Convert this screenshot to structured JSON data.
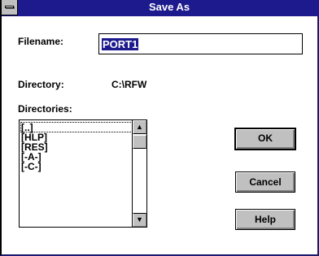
{
  "window": {
    "title": "Save As"
  },
  "filename": {
    "label": "Filename:",
    "value": "PORT1"
  },
  "directory": {
    "label": "Directory:",
    "value": "C:\\RFW"
  },
  "directories": {
    "label": "Directories:",
    "items": [
      "[..]",
      "[HLP]",
      "[RES]",
      "[-A-]",
      "[-C-]"
    ]
  },
  "scrollbar": {
    "up_glyph": "▲",
    "down_glyph": "▼"
  },
  "buttons": {
    "ok": "OK",
    "cancel": "Cancel",
    "help": "Help"
  },
  "colors": {
    "titlebar": "#1c1a8c",
    "face": "#c0c0c0",
    "selection": "#1c1a8c"
  }
}
